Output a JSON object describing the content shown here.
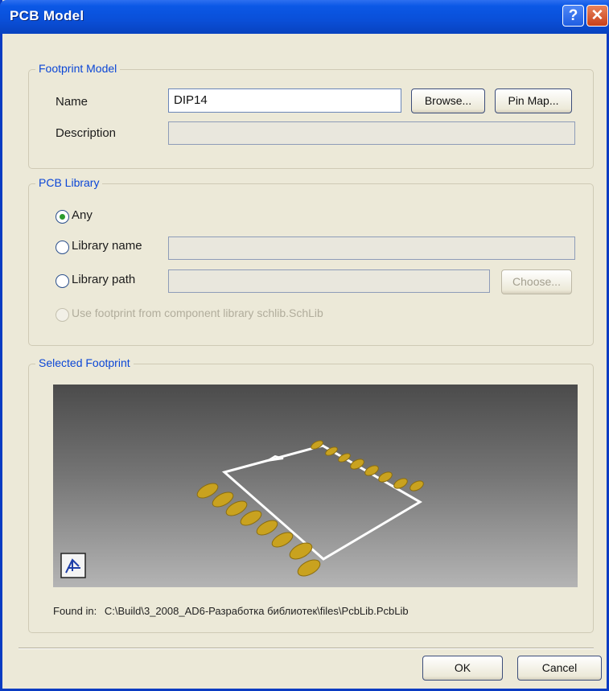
{
  "window": {
    "title": "PCB Model",
    "help_glyph": "?",
    "close_glyph": "✕"
  },
  "footprint_model": {
    "legend": "Footprint Model",
    "name_label": "Name",
    "name_value": "DIP14",
    "browse_label": "Browse...",
    "pin_map_label": "Pin Map...",
    "description_label": "Description",
    "description_value": ""
  },
  "pcb_library": {
    "legend": "PCB Library",
    "options": [
      {
        "label": "Any",
        "checked": true,
        "enabled": true
      },
      {
        "label": "Library name",
        "checked": false,
        "enabled": true
      },
      {
        "label": "Library path",
        "checked": false,
        "enabled": true
      },
      {
        "label": "Use footprint from component library schlib.SchLib",
        "checked": false,
        "enabled": false
      }
    ],
    "library_name_value": "",
    "library_path_value": "",
    "choose_label": "Choose..."
  },
  "selected_footprint": {
    "legend": "Selected Footprint",
    "found_in_label": "Found in:",
    "found_in_path": "C:\\Build\\3_2008_AD6-Разработка библиотек\\files\\PcbLib.PcbLib",
    "view_icon": "3d-view-icon",
    "pad_color": "#c9a21f",
    "outline_color": "#ffffff"
  },
  "buttons": {
    "ok_label": "OK",
    "cancel_label": "Cancel"
  }
}
